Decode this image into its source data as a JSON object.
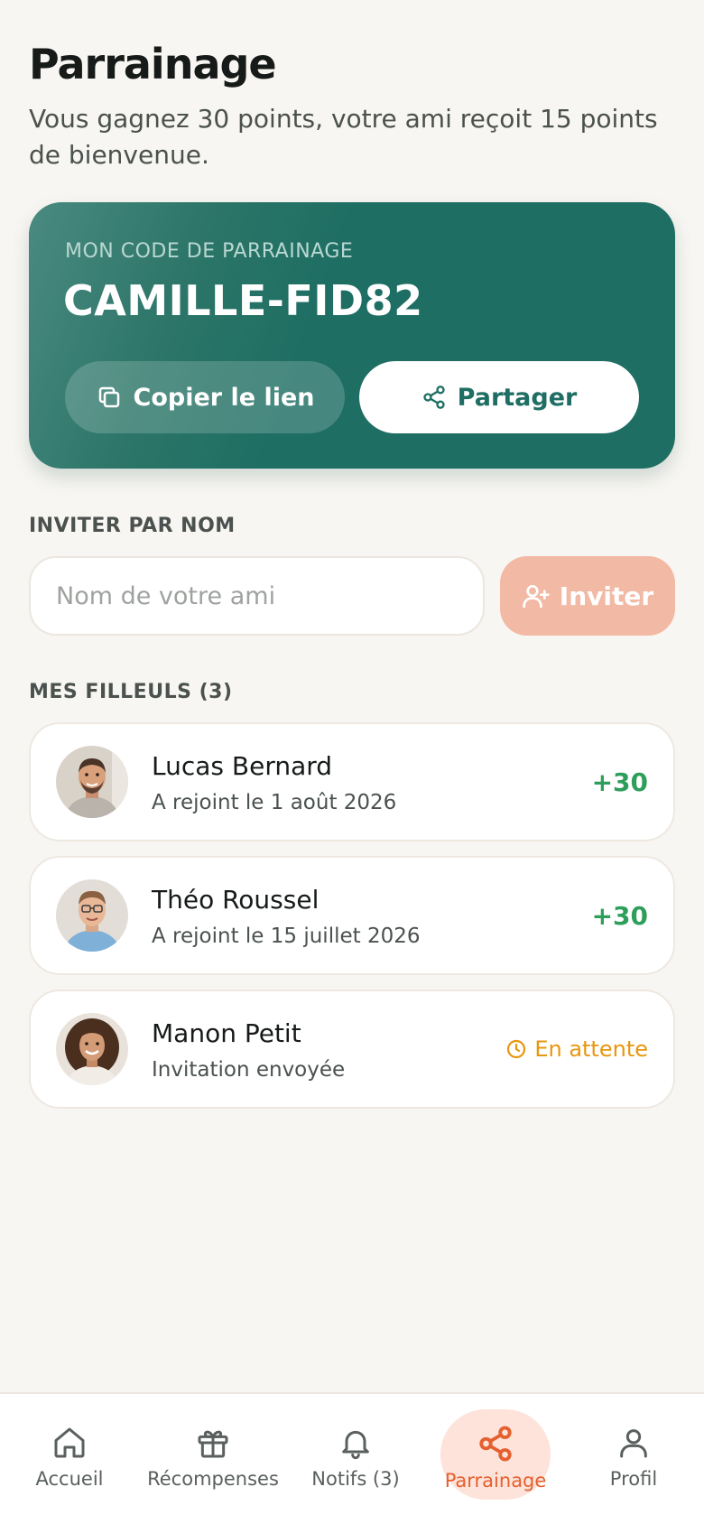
{
  "header": {
    "title": "Parrainage",
    "subtitle": "Vous gagnez 30 points, votre ami reçoit 15 points de bienvenue."
  },
  "code_card": {
    "label": "MON CODE DE PARRAINAGE",
    "code": "CAMILLE-FID82",
    "copy_label": "Copier le lien",
    "share_label": "Partager"
  },
  "invite": {
    "section_label": "INVITER PAR NOM",
    "placeholder": "Nom de votre ami",
    "value": "",
    "button_label": "Inviter"
  },
  "referrals": {
    "section_label": "MES FILLEULS (3)",
    "items": [
      {
        "name": "Lucas Bernard",
        "subtitle": "A rejoint le 1 août 2026",
        "status": "+30",
        "status_type": "points"
      },
      {
        "name": "Théo Roussel",
        "subtitle": "A rejoint le 15 juillet 2026",
        "status": "+30",
        "status_type": "points"
      },
      {
        "name": "Manon Petit",
        "subtitle": "Invitation envoyée",
        "status": "En attente",
        "status_type": "pending"
      }
    ]
  },
  "nav": {
    "items": [
      {
        "label": "Accueil",
        "icon": "home-icon"
      },
      {
        "label": "Récompenses",
        "icon": "gift-icon"
      },
      {
        "label": "Notifs (3)",
        "icon": "bell-icon"
      },
      {
        "label": "Parrainage",
        "icon": "share-icon",
        "active": true
      },
      {
        "label": "Profil",
        "icon": "user-icon"
      }
    ]
  },
  "colors": {
    "brand_green": "#1e6e63",
    "accent_orange": "#e5602f",
    "points_green": "#2e9e5b",
    "pending_orange": "#e8960f",
    "background": "#f8f6f2"
  }
}
